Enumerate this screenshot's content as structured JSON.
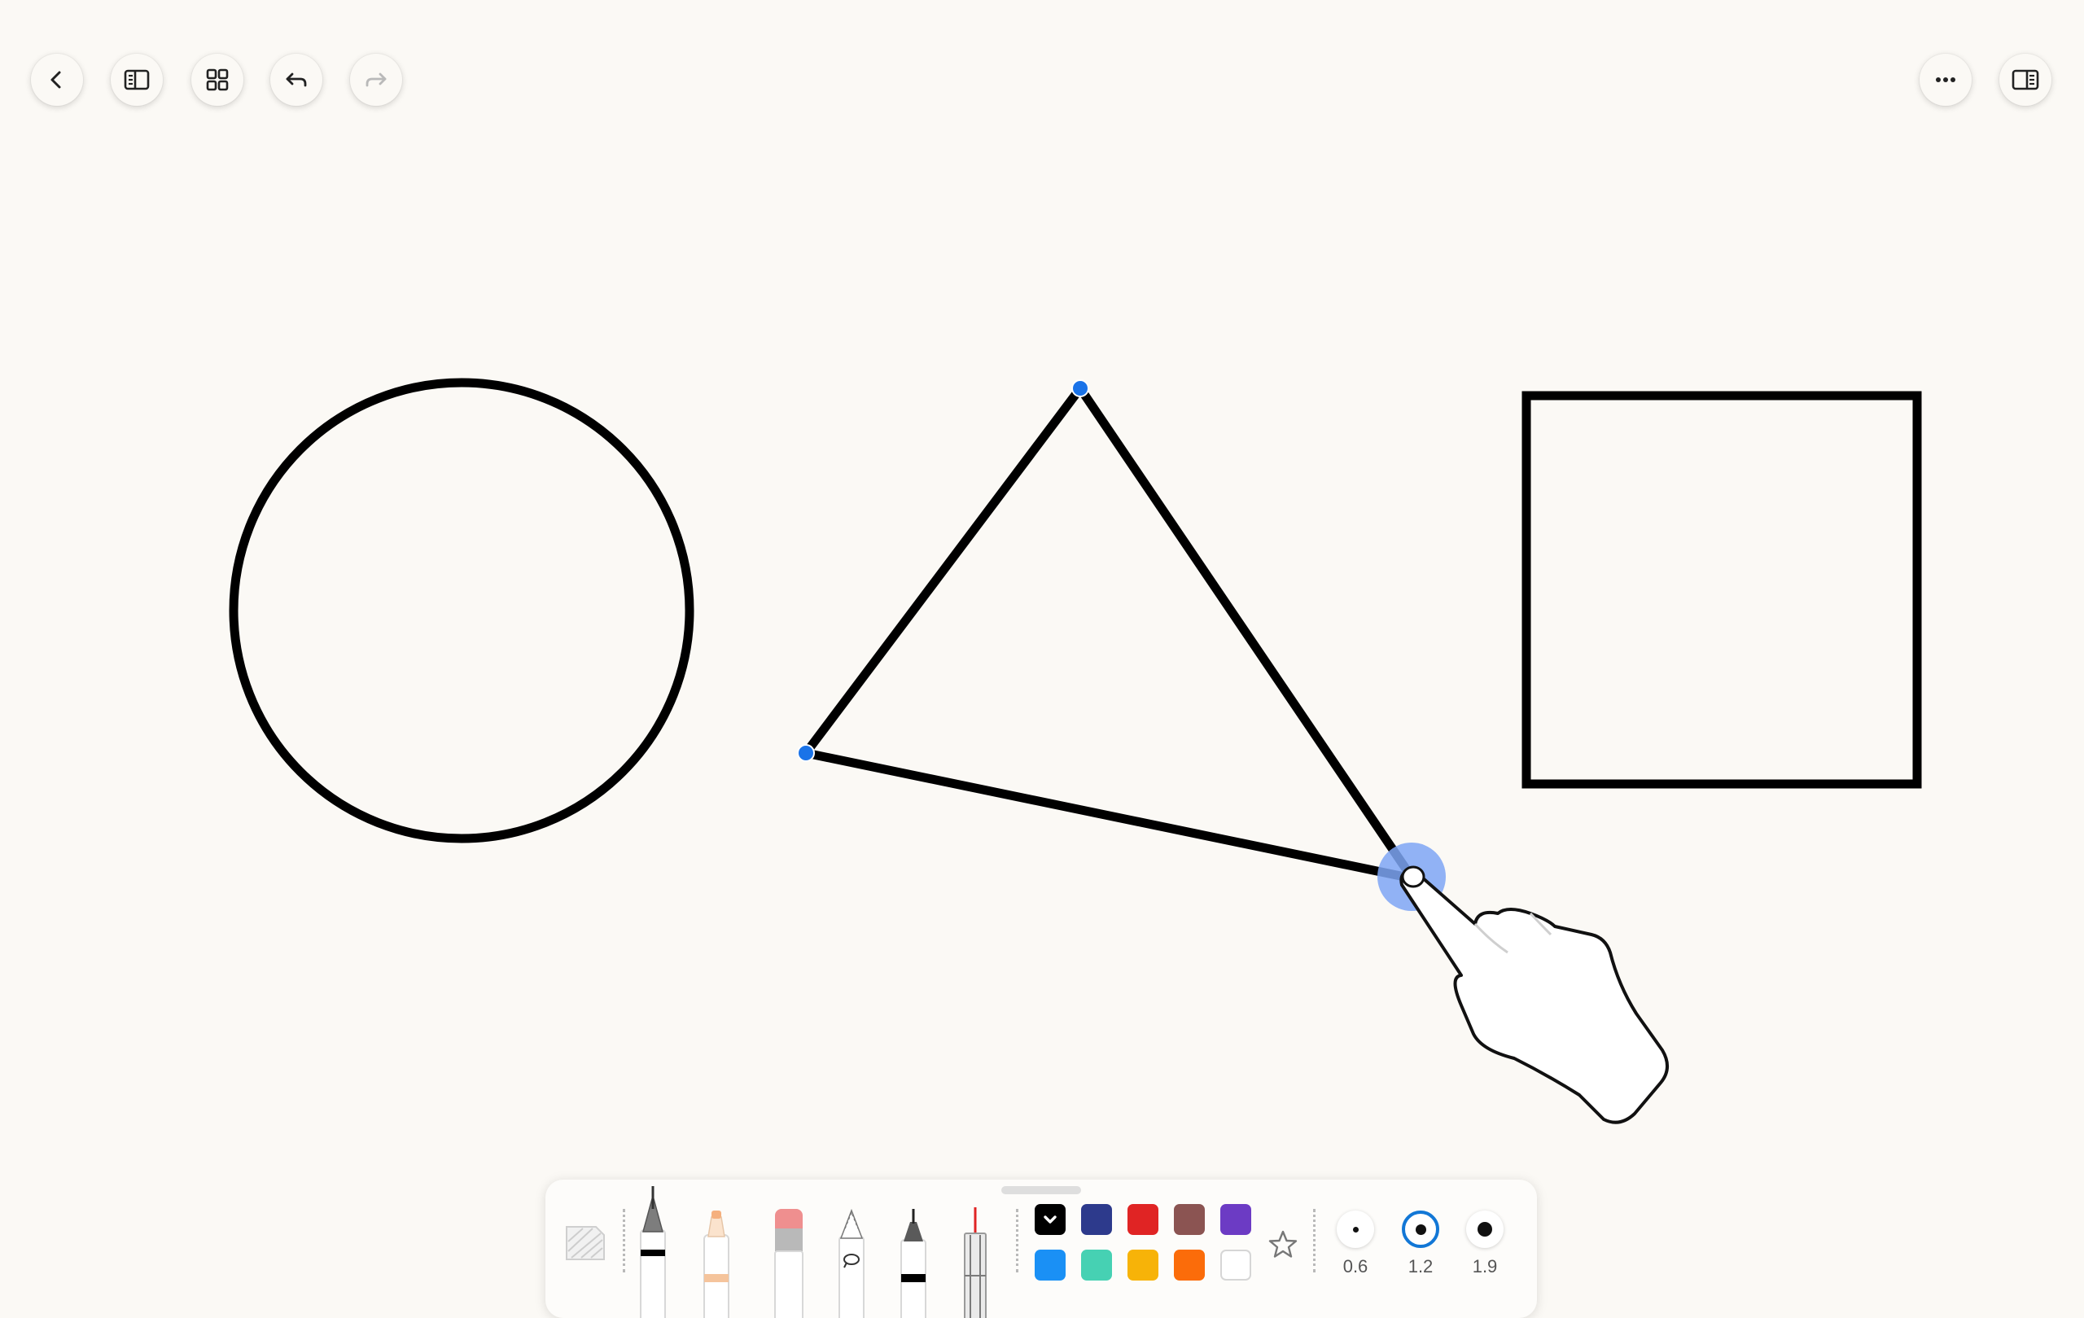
{
  "top_bar": {
    "left_buttons": [
      "back-icon",
      "sidebar-toggle-icon",
      "grid-view-icon",
      "undo-icon",
      "redo-icon"
    ],
    "right_buttons": [
      "more-options-icon",
      "side-panel-icon"
    ]
  },
  "canvas": {
    "shapes": [
      "circle",
      "triangle",
      "square"
    ],
    "stroke_color": "#000000",
    "selection_handle_color": "#1a73e8",
    "touch_indicator_color": "#7ea6f4"
  },
  "toolbar": {
    "tools": [
      "texture-icon",
      "fountain-pen-icon",
      "marker-icon",
      "eraser-icon",
      "lasso-pencil-icon",
      "ink-pen-icon",
      "laser-pointer-icon"
    ],
    "colors": [
      {
        "name": "black",
        "hex": "#000000",
        "selected": true
      },
      {
        "name": "navy",
        "hex": "#2d3a8c",
        "selected": false
      },
      {
        "name": "red",
        "hex": "#e02424",
        "selected": false
      },
      {
        "name": "brown",
        "hex": "#8b5452",
        "selected": false
      },
      {
        "name": "purple",
        "hex": "#6c3bc4",
        "selected": false
      },
      {
        "name": "blue",
        "hex": "#1a90f5",
        "selected": false
      },
      {
        "name": "teal",
        "hex": "#46d1b3",
        "selected": false
      },
      {
        "name": "yellow",
        "hex": "#f7b308",
        "selected": false
      },
      {
        "name": "orange",
        "hex": "#fb6c0a",
        "selected": false
      },
      {
        "name": "white",
        "hex": "#ffffff",
        "selected": false
      }
    ],
    "favorite_icon": "star-icon",
    "sizes": [
      {
        "label": "0.6",
        "selected": false
      },
      {
        "label": "1.2",
        "selected": true
      },
      {
        "label": "1.9",
        "selected": false
      }
    ]
  }
}
